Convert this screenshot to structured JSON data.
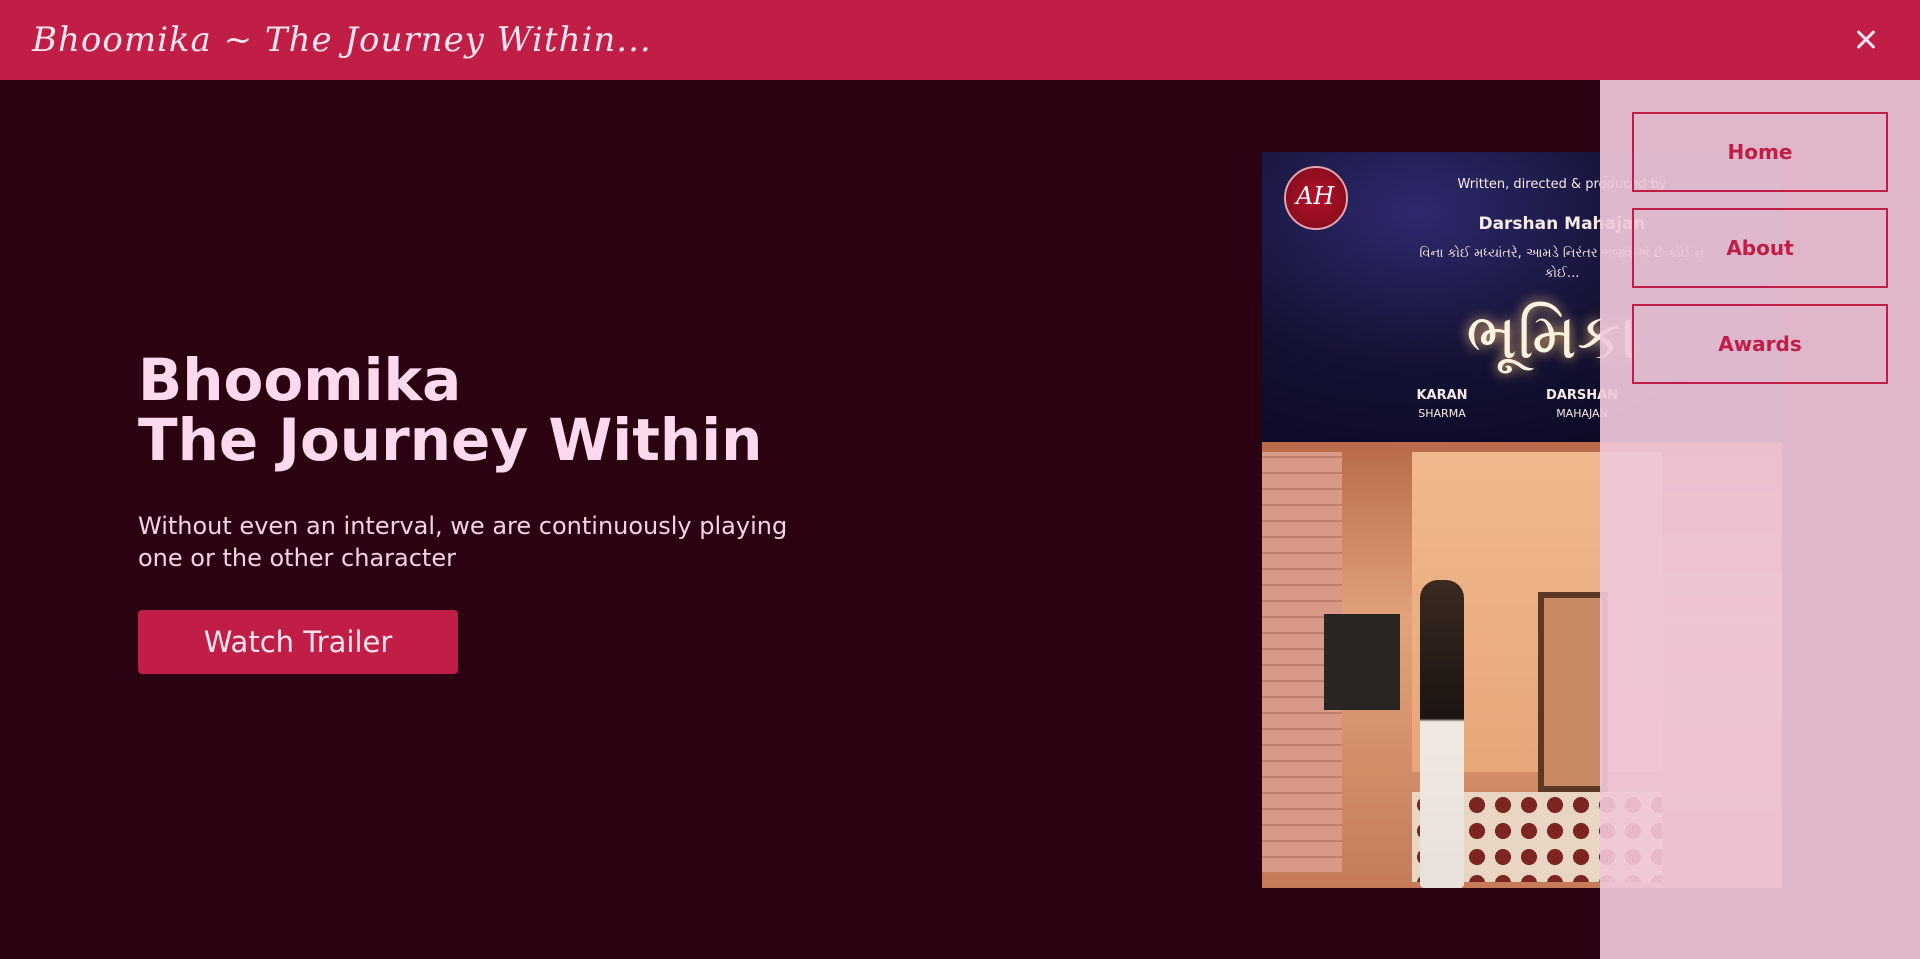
{
  "header": {
    "brand": "Bhoomika ~ The Journey Within..."
  },
  "hero": {
    "title_line1": "Bhoomika",
    "title_line2": "The Journey Within",
    "description": "Without even an interval, we are continuously playing one or the other character",
    "cta_label": "Watch Trailer"
  },
  "poster": {
    "credit": "Written, directed & produced by",
    "director": "Darshan Mahajan",
    "tagline_gujarati": "વિના કોઈ મધ્યાંતરે, આમડે નિરંતર ભજવીએ છે કોઈ ન કોઈ...",
    "title_gujarati": "ભૂમિકા",
    "cast": [
      {
        "first": "KARAN",
        "last": "SHARMA"
      },
      {
        "first": "DARSHAN",
        "last": "MAHAJAN"
      }
    ]
  },
  "nav": {
    "items": [
      {
        "label": "Home"
      },
      {
        "label": "About"
      },
      {
        "label": "Awards"
      }
    ]
  },
  "colors": {
    "background": "#2a0212",
    "accent": "#c11e47",
    "drawer": "#f0c7da",
    "title_text": "#fcd9ec"
  }
}
